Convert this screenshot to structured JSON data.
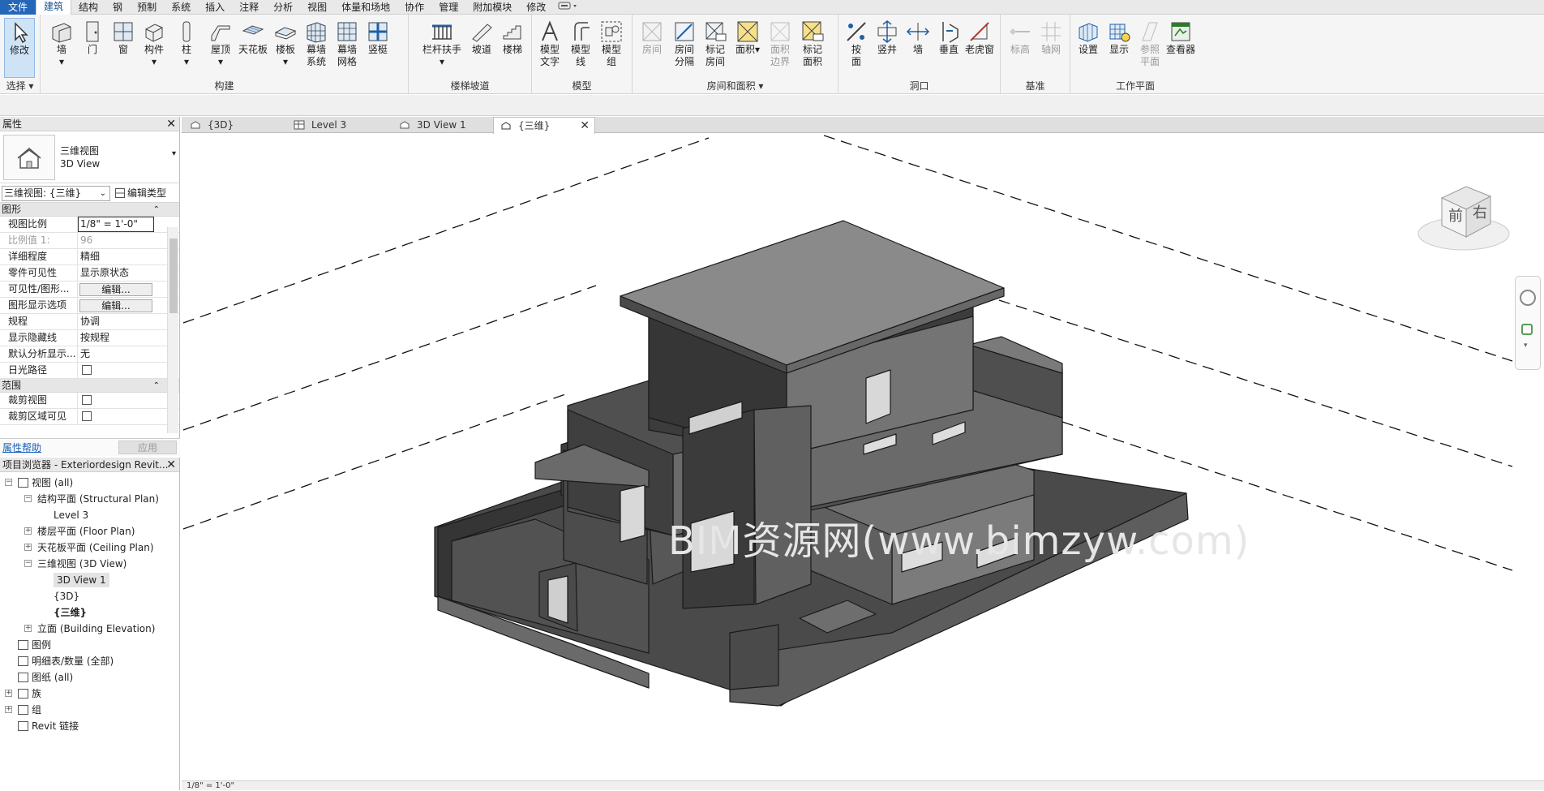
{
  "menu_tabs": [
    "文件",
    "建筑",
    "结构",
    "钢",
    "预制",
    "系统",
    "插入",
    "注释",
    "分析",
    "视图",
    "体量和场地",
    "协作",
    "管理",
    "附加模块",
    "修改"
  ],
  "active_tab": "建筑",
  "ribbon": {
    "select": {
      "modify": "修改",
      "title": "选择"
    },
    "build": {
      "title": "构建",
      "wall": "墙",
      "door": "门",
      "window": "窗",
      "component": "构件",
      "column": "柱",
      "roof": "屋顶",
      "ceiling": "天花板",
      "floor": "楼板",
      "curtain_system": "幕墙系统",
      "curtain_grid": "幕墙网格",
      "mullion": "竖梃"
    },
    "circulation": {
      "title": "楼梯坡道",
      "railing": "栏杆扶手",
      "ramp": "坡道",
      "stair": "楼梯"
    },
    "model": {
      "title": "模型",
      "model_text": "模型文字",
      "model_line": "模型线",
      "model_group": "模型组"
    },
    "room_area": {
      "title": "房间和面积",
      "room": "房间",
      "room_separator": "房间分隔",
      "tag_room": "标记房间",
      "area": "面积",
      "area_boundary": "面积边界",
      "tag_area": "标记面积"
    },
    "opening": {
      "title": "洞口",
      "by_face": "按面",
      "shaft": "竖井",
      "wall": "墙",
      "vertical": "垂直",
      "dormer": "老虎窗"
    },
    "datum": {
      "title": "基准",
      "level": "标高",
      "grid": "轴网"
    },
    "workplane": {
      "title": "工作平面",
      "set": "设置",
      "show": "显示",
      "ref_plane": "参照平面",
      "viewer": "查看器"
    }
  },
  "properties": {
    "title": "属性",
    "type_name_cn": "三维视图",
    "type_name_en": "3D View",
    "view_selector": "三维视图: {三维}",
    "edit_type": "编辑类型",
    "sections": {
      "graphics": "图形",
      "extents": "范围"
    },
    "rows": [
      {
        "k": "视图比例",
        "v": "1/8\" = 1'-0\""
      },
      {
        "k": "比例值 1:",
        "v": "96"
      },
      {
        "k": "详细程度",
        "v": "精细"
      },
      {
        "k": "零件可见性",
        "v": "显示原状态"
      },
      {
        "k": "可见性/图形...",
        "v": "编辑..."
      },
      {
        "k": "图形显示选项",
        "v": "编辑..."
      },
      {
        "k": "规程",
        "v": "协调"
      },
      {
        "k": "显示隐藏线",
        "v": "按规程"
      },
      {
        "k": "默认分析显示...",
        "v": "无"
      },
      {
        "k": "日光路径",
        "v": ""
      },
      {
        "k": "裁剪视图",
        "v": ""
      },
      {
        "k": "裁剪区域可见",
        "v": ""
      }
    ],
    "help": "属性帮助",
    "apply": "应用"
  },
  "browser": {
    "title": "项目浏览器 - Exteriordesign Revit...",
    "items": [
      "视图 (all)",
      "结构平面 (Structural Plan)",
      "Level 3",
      "楼层平面 (Floor Plan)",
      "天花板平面 (Ceiling Plan)",
      "三维视图 (3D View)",
      "3D View 1",
      "{3D}",
      "{三维}",
      "立面 (Building Elevation)",
      "图例",
      "明细表/数量 (全部)",
      "图纸 (all)",
      "族",
      "组",
      "Revit 链接"
    ]
  },
  "view_tabs": [
    "{3D}",
    "Level 3",
    "3D View 1",
    "{三维}"
  ],
  "active_view_tab": "{三维}",
  "viewcube": {
    "front": "前",
    "right": "右"
  },
  "watermark": "BIM资源网(www.bimzyw.com)",
  "status": "1/8\" = 1'-0\""
}
